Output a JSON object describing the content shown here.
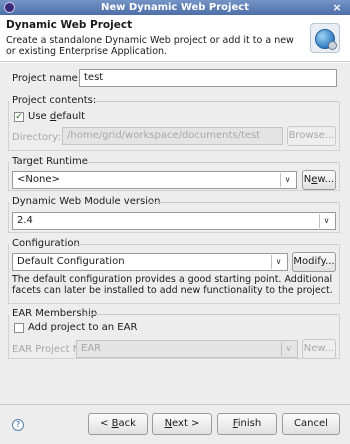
{
  "window": {
    "title": "New Dynamic Web Project",
    "close": "×"
  },
  "header": {
    "title": "Dynamic Web Project",
    "description": "Create a standalone Dynamic Web project or add it to a new or existing Enterprise Application."
  },
  "project_name": {
    "label": "Project name:",
    "value": "test"
  },
  "project_contents": {
    "title": "Project contents:",
    "use_default_pre": "Use ",
    "use_default_accel": "d",
    "use_default_post": "efault",
    "use_default_checked": true,
    "check_glyph": "✓",
    "directory_label": "Directory:",
    "directory_value": "/home/grid/workspace/documents/test",
    "browse_label": "Browse..."
  },
  "target_runtime": {
    "title": "Target Runtime",
    "value": "<None>",
    "new_pre": "N",
    "new_accel": "e",
    "new_post": "w..."
  },
  "module_version": {
    "title": "Dynamic Web Module version",
    "value": "2.4"
  },
  "configuration": {
    "title": "Configuration",
    "value": "Default Configuration",
    "modify_pre": "Modify",
    "modify_post": "...",
    "description": "The default configuration provides a good starting point. Additional facets can later be installed to add new functionality to the project."
  },
  "ear": {
    "title": "EAR Membership",
    "add_label": "Add project to an EAR",
    "add_checked": false,
    "project_name_label": "EAR Project Name:",
    "project_name_value": "EAR",
    "new_label": "New..."
  },
  "footer": {
    "help": "?",
    "back_pre": "< ",
    "back_accel": "B",
    "back_post": "ack",
    "next_accel": "N",
    "next_post": "ext >",
    "finish_accel": "F",
    "finish_post": "inish",
    "cancel": "Cancel"
  },
  "icons": {
    "arrow": "∨"
  }
}
